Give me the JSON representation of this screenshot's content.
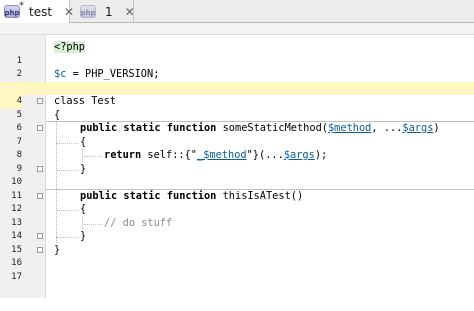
{
  "tabs": [
    {
      "icon": "php-file-icon",
      "icon_text": "php",
      "label": "test",
      "close": "✕",
      "active": true,
      "modified": true
    },
    {
      "icon": "php-file-icon",
      "icon_text": "php",
      "label": "1",
      "close": "✕",
      "active": false,
      "modified": false
    }
  ],
  "editor": {
    "current_line": 4,
    "lines": [
      {
        "n": "1"
      },
      {
        "n": "2"
      },
      {
        "n": "3"
      },
      {
        "n": "4"
      },
      {
        "n": "5"
      },
      {
        "n": "6"
      },
      {
        "n": "7"
      },
      {
        "n": "8"
      },
      {
        "n": "9"
      },
      {
        "n": "10"
      },
      {
        "n": "11"
      },
      {
        "n": "12"
      },
      {
        "n": "13"
      },
      {
        "n": "14"
      },
      {
        "n": "15"
      },
      {
        "n": "16"
      },
      {
        "n": "17"
      }
    ],
    "code": {
      "l1": {
        "open_tag": "<?php"
      },
      "l3": {
        "var": "$c",
        "assign": " = ",
        "const": "PHP_VERSION",
        "semi": ";"
      },
      "l5": {
        "kw": "class",
        "name": " Test"
      },
      "l6": {
        "brace": "{"
      },
      "l7": {
        "mods": "public static function",
        "name": " someStaticMethod(",
        "p1": "$method",
        "sep": ", ...",
        "p2": "$args",
        "end": ")"
      },
      "l8": {
        "brace": "{"
      },
      "l9": {
        "kw": "return",
        "mid": " self::{\"",
        "interp_prefix": "_",
        "interp_var": "$method",
        "mid2": "\"}(...",
        "arg": "$args",
        "end": ");"
      },
      "l10": {
        "brace": "}"
      },
      "l12": {
        "mods": "public static function",
        "name": " thisIsATest()"
      },
      "l13": {
        "brace": "{"
      },
      "l14": {
        "comment": "// do stuff"
      },
      "l15": {
        "brace": "}"
      },
      "l16": {
        "brace": "}"
      }
    }
  },
  "colors": {
    "current_line": "#fff7c2",
    "variable": "#0b5ea0",
    "comment": "#8a8a8a",
    "php_tag_bg": "#d7f0d7"
  }
}
